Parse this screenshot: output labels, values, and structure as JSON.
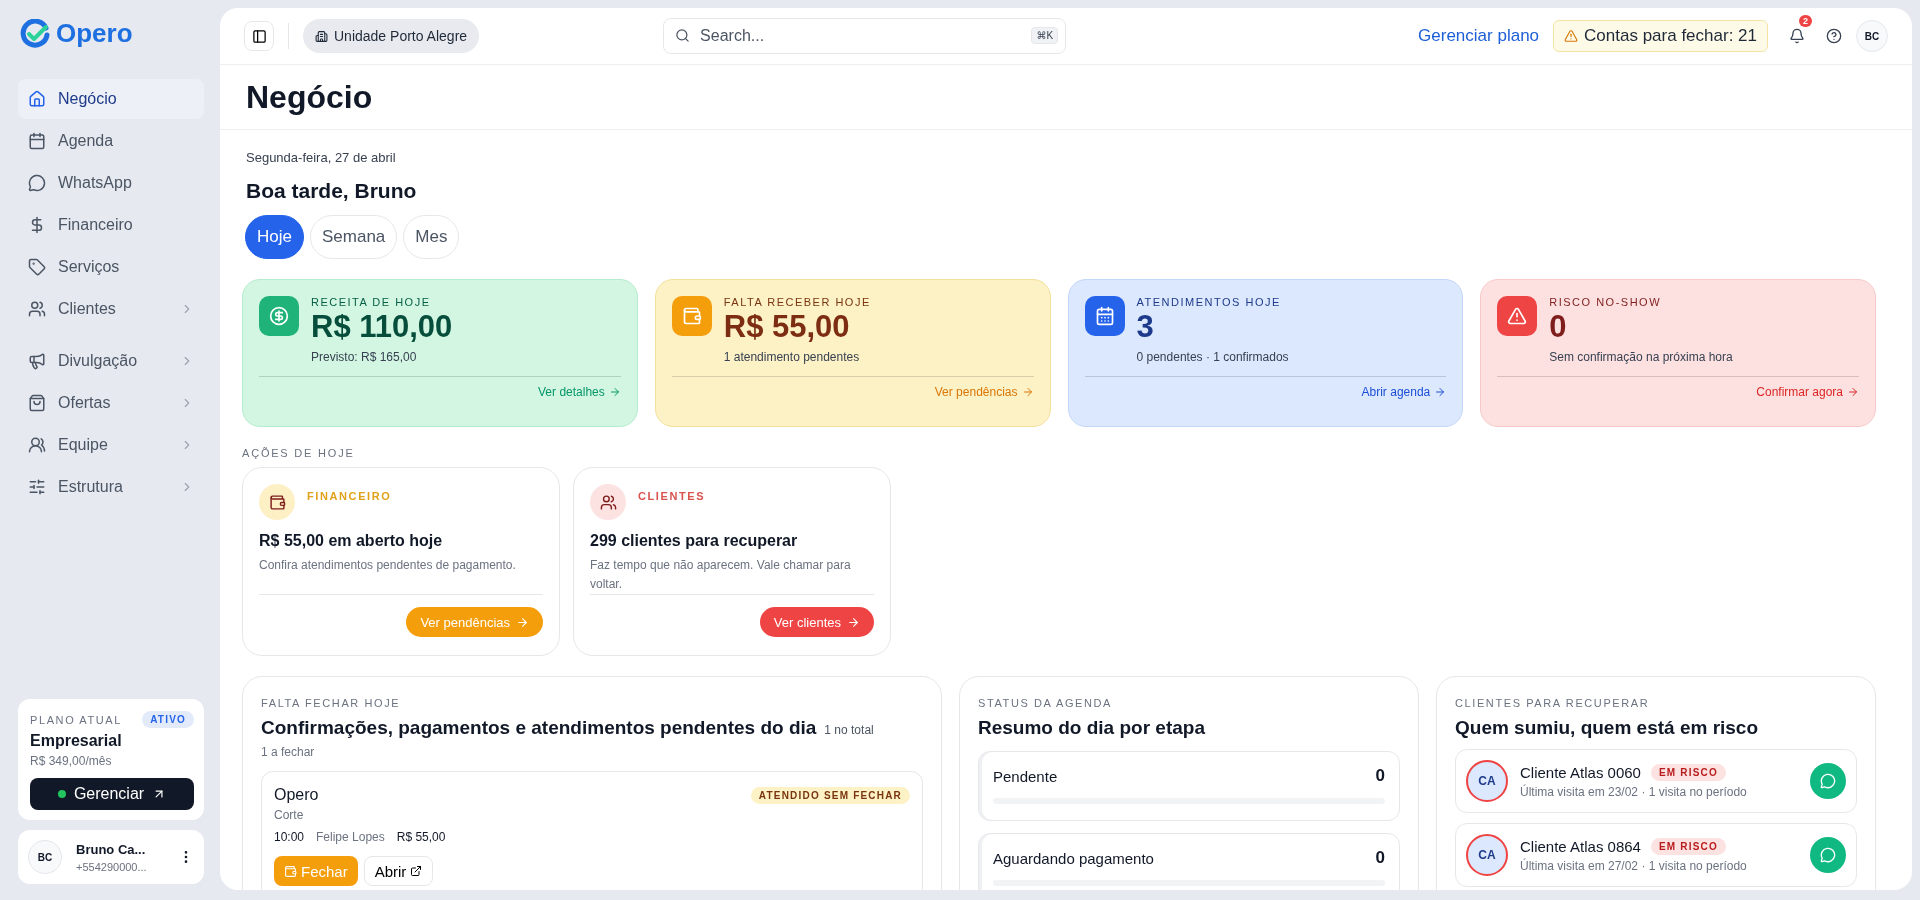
{
  "sidebar": {
    "logo": "Opero",
    "nav_groups": [
      [
        {
          "label": "Negócio",
          "selected": true,
          "expandable": false
        },
        {
          "label": "Agenda",
          "selected": false,
          "expandable": false
        },
        {
          "label": "WhatsApp",
          "selected": false,
          "expandable": false
        },
        {
          "label": "Financeiro",
          "selected": false,
          "expandable": false
        },
        {
          "label": "Serviços",
          "selected": false,
          "expandable": false
        },
        {
          "label": "Clientes",
          "selected": false,
          "expandable": true
        }
      ],
      [
        {
          "label": "Divulgação",
          "selected": false,
          "expandable": true
        },
        {
          "label": "Ofertas",
          "selected": false,
          "expandable": true
        },
        {
          "label": "Equipe",
          "selected": false,
          "expandable": true
        },
        {
          "label": "Estrutura",
          "selected": false,
          "expandable": true
        }
      ]
    ],
    "plan": {
      "label": "PLANO ATUAL",
      "badge": "ATIVO",
      "name": "Empresarial",
      "price": "R$ 349,00/mês",
      "button": "Gerenciar"
    },
    "user": {
      "initials": "BC",
      "name": "Bruno Ca...",
      "phone": "+554290000..."
    }
  },
  "topbar": {
    "unit": "Unidade Porto Alegre",
    "search": {
      "placeholder": "Search..."
    },
    "shortcut": "⌘K",
    "plan_link": "Gerenciar plano",
    "alert": "Contas para fechar: 21",
    "notifications": "2",
    "avatar": "BC"
  },
  "page": {
    "title": "Negócio",
    "date": "Segunda-feira, 27 de abril",
    "greeting": "Boa tarde, Bruno",
    "periods": [
      {
        "label": "Hoje",
        "selected": true
      },
      {
        "label": "Semana",
        "selected": false
      },
      {
        "label": "Mes",
        "selected": false
      }
    ]
  },
  "kpis": [
    {
      "kind": "success",
      "label": "RECEITA DE HOJE",
      "value": "R$ 110,00",
      "note": "Previsto: R$ 165,00",
      "link": "Ver detalhes"
    },
    {
      "kind": "warning",
      "label": "FALTA RECEBER HOJE",
      "value": "R$ 55,00",
      "note": "1 atendimento pendentes",
      "link": "Ver pendências"
    },
    {
      "kind": "info",
      "label": "ATENDIMENTOS HOJE",
      "value": "3",
      "note": "0 pendentes · 1 confirmados",
      "link": "Abrir agenda"
    },
    {
      "kind": "danger",
      "label": "RISCO NO-SHOW",
      "value": "0",
      "note": "Sem confirmação na próxima hora",
      "link": "Confirmar agora"
    }
  ],
  "actions": {
    "title": "AÇÕES DE HOJE",
    "cards": [
      {
        "kind": "warning",
        "category": "FINANCEIRO",
        "title": "R$ 55,00 em aberto hoje",
        "description": "Confira atendimentos pendentes de pagamento.",
        "button": "Ver pendências"
      },
      {
        "kind": "danger",
        "category": "CLIENTES",
        "title": "299 clientes para recuperar",
        "description": "Faz tempo que não aparecem. Vale chamar para voltar.",
        "button": "Ver clientes"
      }
    ]
  },
  "pending": {
    "eyebrow": "FALTA FECHAR HOJE",
    "title": "Confirmações, pagamentos e atendimentos pendentes do dia",
    "count": "1 no total",
    "subtitle": "1 a fechar",
    "items": [
      {
        "name": "Opero",
        "service": "Corte",
        "status": "ATENDIDO SEM FECHAR",
        "time": "10:00",
        "staff": "Felipe Lopes",
        "price": "R$ 55,00",
        "close_button": "Fechar",
        "open_button": "Abrir"
      }
    ]
  },
  "agenda": {
    "eyebrow": "STATUS DA AGENDA",
    "title": "Resumo do dia por etapa",
    "stages": [
      {
        "label": "Pendente",
        "count": "0",
        "level": 0
      },
      {
        "label": "Aguardando pagamento",
        "count": "0",
        "level": 0
      }
    ]
  },
  "recover": {
    "eyebrow": "CLIENTES PARA RECUPERAR",
    "title": "Quem sumiu, quem está em risco",
    "clients": [
      {
        "initials": "CA",
        "name": "Cliente Atlas 0060",
        "badge": "EM RISCO",
        "meta": "Última visita em 23/02 · 1 visita no período"
      },
      {
        "initials": "CA",
        "name": "Cliente Atlas 0864",
        "badge": "EM RISCO",
        "meta": "Última visita em 27/02 · 1 visita no período"
      }
    ]
  }
}
